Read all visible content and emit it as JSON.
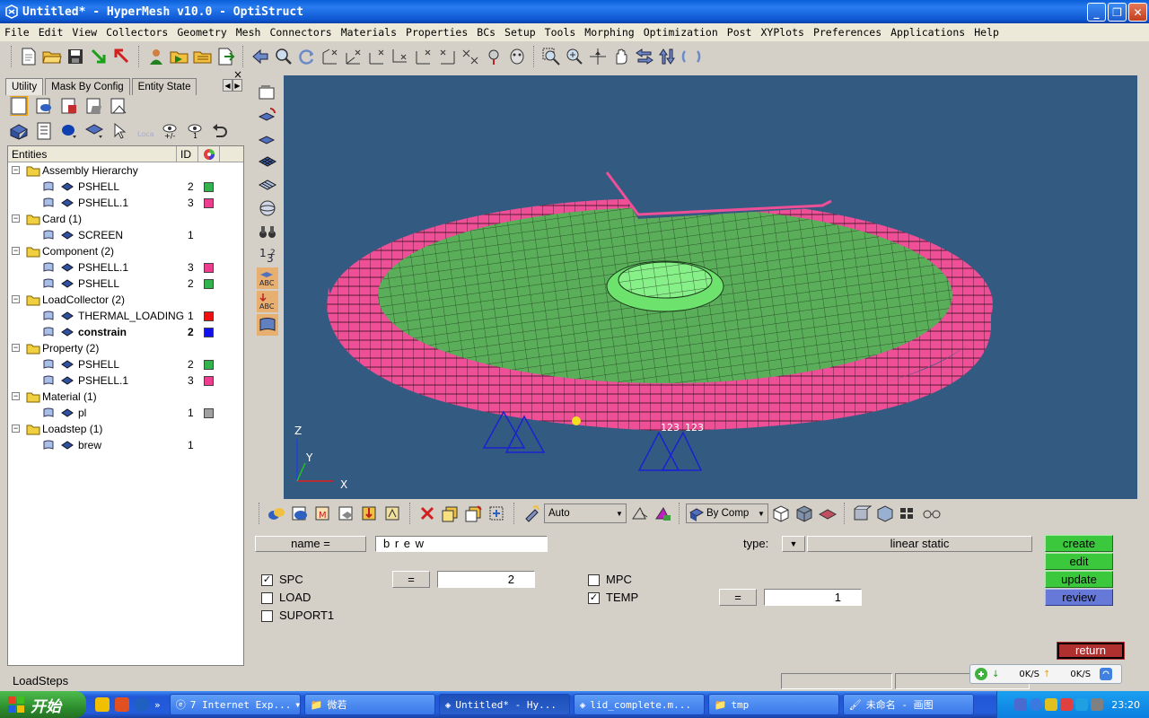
{
  "window": {
    "title": "Untitled* - HyperMesh v10.0 - OptiStruct"
  },
  "menu": [
    "File",
    "Edit",
    "View",
    "Collectors",
    "Geometry",
    "Mesh",
    "Connectors",
    "Materials",
    "Properties",
    "BCs",
    "Setup",
    "Tools",
    "Morphing",
    "Optimization",
    "Post",
    "XYPlots",
    "Preferences",
    "Applications",
    "Help"
  ],
  "tabs": [
    "Utility",
    "Mask By Config",
    "Entity State"
  ],
  "tree": {
    "headers": {
      "entities": "Entities",
      "id": "ID"
    },
    "rows": [
      {
        "label": "Assembly Hierarchy",
        "level": 0,
        "id": "",
        "color": ""
      },
      {
        "label": "PSHELL",
        "level": 1,
        "id": "2",
        "color": "#33b34d"
      },
      {
        "label": "PSHELL.1",
        "level": 1,
        "id": "3",
        "color": "#ee3d8e"
      },
      {
        "label": "Card (1)",
        "level": 0,
        "id": "",
        "color": ""
      },
      {
        "label": "SCREEN",
        "level": 1,
        "id": "1",
        "color": ""
      },
      {
        "label": "Component (2)",
        "level": 0,
        "id": "",
        "color": ""
      },
      {
        "label": "PSHELL.1",
        "level": 1,
        "id": "3",
        "color": "#ee3d8e"
      },
      {
        "label": "PSHELL",
        "level": 1,
        "id": "2",
        "color": "#33b34d"
      },
      {
        "label": "LoadCollector (2)",
        "level": 0,
        "id": "",
        "color": ""
      },
      {
        "label": "THERMAL_LOADING",
        "level": 1,
        "id": "1",
        "color": "#ee1111"
      },
      {
        "label": "constrain",
        "level": 1,
        "id": "2",
        "color": "#1111ee",
        "bold": true
      },
      {
        "label": "Property (2)",
        "level": 0,
        "id": "",
        "color": ""
      },
      {
        "label": "PSHELL",
        "level": 1,
        "id": "2",
        "color": "#33b34d"
      },
      {
        "label": "PSHELL.1",
        "level": 1,
        "id": "3",
        "color": "#ee3d8e"
      },
      {
        "label": "Material (1)",
        "level": 0,
        "id": "",
        "color": ""
      },
      {
        "label": "pl",
        "level": 1,
        "id": "1",
        "color": "#a0a0a0"
      },
      {
        "label": "Loadstep (1)",
        "level": 0,
        "id": "",
        "color": ""
      },
      {
        "label": "brew",
        "level": 1,
        "id": "1",
        "color": ""
      }
    ]
  },
  "viewport": {
    "axis_x": "X",
    "axis_y": "Y",
    "axis_z": "Z",
    "label_a": "123",
    "label_b": "123"
  },
  "bottombar": {
    "auto_label": "Auto",
    "bycomp_label": "By Comp"
  },
  "panel": {
    "name_label": "name   =",
    "name_value": "b r e w",
    "type_label": "type:",
    "type_value": "linear static",
    "spc_label": "SPC",
    "spc_checked": true,
    "spc_eq": "=",
    "spc_value": "2",
    "load_label": "LOAD",
    "suport_label": "SUPORT1",
    "mpc_label": "MPC",
    "temp_label": "TEMP",
    "temp_checked": true,
    "temp_eq": "=",
    "temp_value": "1",
    "create": "create",
    "edit": "edit",
    "update": "update",
    "review": "review",
    "return": "return"
  },
  "status": {
    "text": "LoadSteps"
  },
  "netmon": {
    "down": "0K/S",
    "up": "0K/S"
  },
  "taskbar": {
    "start": "开始",
    "buttons": [
      "7 Internet Exp...",
      "微若",
      "Untitled* - Hy...",
      "lid_complete.m...",
      "tmp",
      "未命名 - 画图"
    ],
    "time": "23:20"
  }
}
